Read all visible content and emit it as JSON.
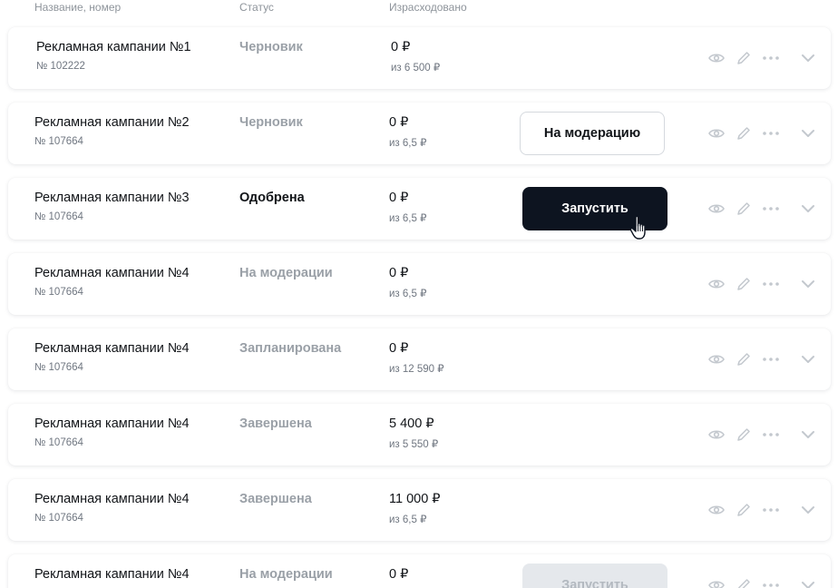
{
  "columns": {
    "name": "Название, номер",
    "status": "Статус",
    "spent": "Израсходовано"
  },
  "rows": [
    {
      "name": "Рекламная кампании №1",
      "number": "№ 102222",
      "status": "Черновик",
      "amount": "0 ₽",
      "budget": "из 6 500 ₽",
      "action": ""
    },
    {
      "name": "Рекламная кампании №2",
      "number": "№ 107664",
      "status": "Черновик",
      "amount": "0 ₽",
      "budget": "из 6,5 ₽",
      "action": "На модерацию"
    },
    {
      "name": "Рекламная кампании №3",
      "number": "№ 107664",
      "status": "Одобрена",
      "amount": "0 ₽",
      "budget": "из 6,5 ₽",
      "action": "Запустить"
    },
    {
      "name": "Рекламная кампании №4",
      "number": "№ 107664",
      "status": "На модерации",
      "amount": "0 ₽",
      "budget": "из 6,5 ₽",
      "action": ""
    },
    {
      "name": "Рекламная кампании №4",
      "number": "№ 107664",
      "status": "Запланирована",
      "amount": "0 ₽",
      "budget": "из 12 590 ₽",
      "action": ""
    },
    {
      "name": "Рекламная кампании №4",
      "number": "№ 107664",
      "status": "Завершена",
      "amount": "5 400 ₽",
      "budget": "из 5 550 ₽",
      "action": ""
    },
    {
      "name": "Рекламная кампании №4",
      "number": "№ 107664",
      "status": "Завершена",
      "amount": "11 000 ₽",
      "budget": "из 6,5 ₽",
      "action": ""
    },
    {
      "name": "Рекламная кампании №4",
      "number": "",
      "status": "На модерации",
      "amount": "0 ₽",
      "budget": "",
      "action": "Запустить"
    }
  ],
  "icons": [
    "eye-icon",
    "pencil-icon",
    "more-dots-icon",
    "chevron-down-icon",
    "hand-pointer-cursor-icon"
  ],
  "colors": {
    "primary_button": "#0d1420",
    "muted_status": "#9aa0a7",
    "disabled_button": "#e5e8ec",
    "icon_gray": "#c3c8ce"
  }
}
